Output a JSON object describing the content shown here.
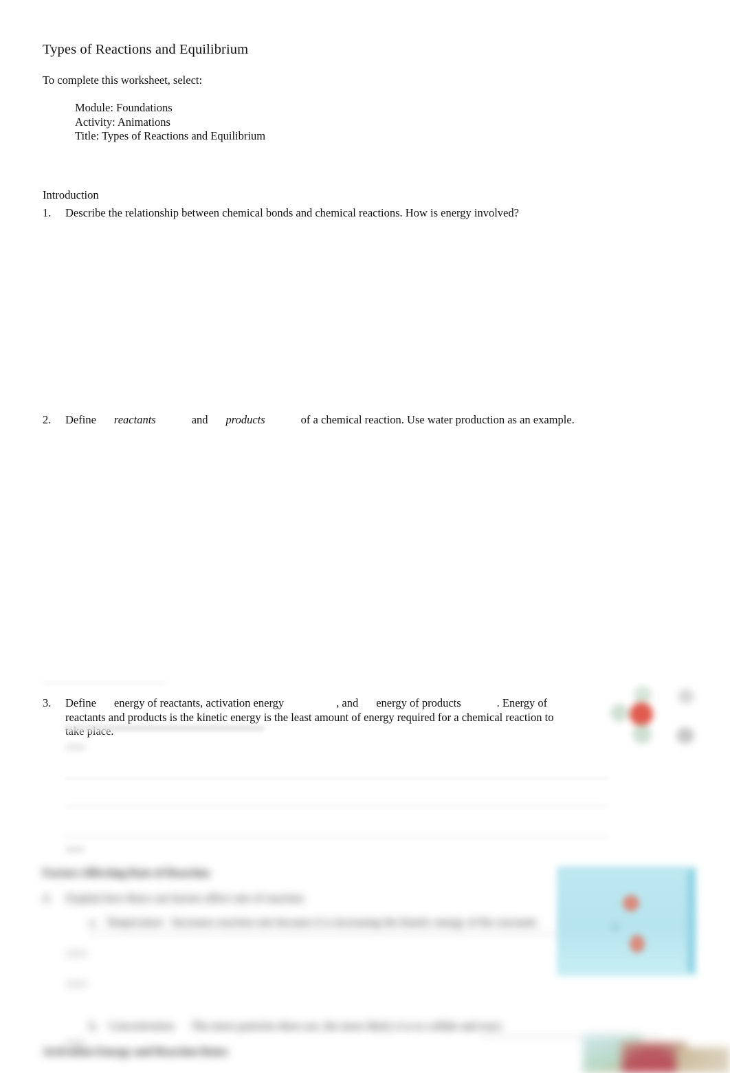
{
  "document": {
    "title": "Types of Reactions and Equilibrium",
    "intro_instruction": "To complete this worksheet, select:",
    "selection_path": [
      "Module: Foundations",
      "Activity: Animations",
      "Title: Types of Reactions and Equilibrium"
    ]
  },
  "sections": {
    "introduction": {
      "heading": "Introduction",
      "questions": [
        {
          "number": "1.",
          "text": "Describe the relationship between chemical bonds and chemical reactions. How is energy involved?"
        },
        {
          "number": "2.",
          "prefix": "Define",
          "term_1": "reactants",
          "conjunction": "and",
          "term_2": "products",
          "suffix": "of a chemical reaction. Use water production as an example."
        },
        {
          "number": "3.",
          "prefix": "Define",
          "term_1": "energy of reactants, activation energy",
          "mid": ", and",
          "term_2": "energy of products",
          "suffix": ". Energy of reactants and products is the kinetic energy is the least amount of energy required for a chemical reaction to take place."
        }
      ]
    },
    "factors_section": {
      "heading": "Factors Affecting Rate of Reaction",
      "question_number": "4.",
      "question_text": "Explain how these can factors affect rate of reaction:",
      "subitems": [
        {
          "label": "a.",
          "term": "Temperature",
          "text": "Increases reaction rate because it is increasing the kinetic energy of the reactants"
        },
        {
          "label": "b.",
          "term": "Concentration",
          "text": "The more particles there are, the more likely it is to collide and react"
        }
      ]
    },
    "activation_section": {
      "heading": "Activation Energy and Reaction Rates"
    }
  },
  "colors": {
    "page_background": "#ffffff",
    "body_text": "#111111",
    "answer_line": "#d8d8d8",
    "figure_molecule_red": "#e05a4e",
    "figure_molecule_green": "#cfe0d2",
    "figure_beaker_cyan": "#bfe8f0",
    "figure_beaker_blob": "#d98d7e"
  }
}
